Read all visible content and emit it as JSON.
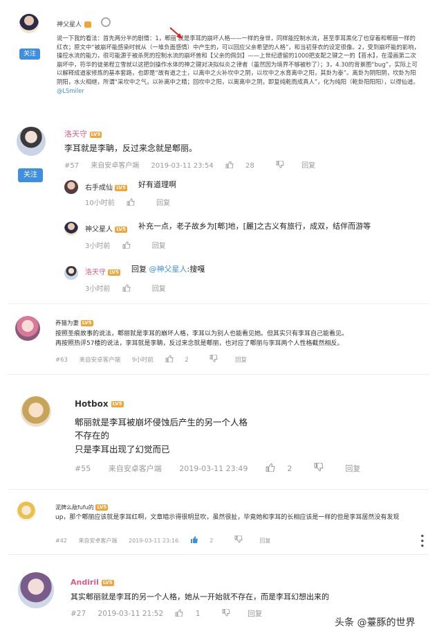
{
  "c1": {
    "name": "神父星人",
    "follow": "关注",
    "text": "说一下我的看法：首先两分半的剧情：1，郫丽 就是李耳的崩坏人格——一样的身世，同样能控制水流，甚至李耳黑化了也穿着和郫丽一样的红衣；原文中“被崩坏能感染时就从（一堆负面感情）中产生的，可以回应父亲希望的人格”，和当初芽衣的设定很像。2，受到崩坏能的影响，操控水流的能力，很可能源于被杀死的控制水流的崩坏兽和【父亲的佩剑】——上世纪遗留的1000把支配之键之一的【苔水】，在漫画第二次崩坏中，符华的徒弟程立雪就以这把剑操作水体的神之键对决拟似炎之律者（虽然因为境界不够被秒了）；3，4.30的背景图“bug”，实际上可以解释成道家修炼的基本套路，也即是“故有道之士，以离中之火补坎中之阴，以坎中之水育离中之阳，其卦为泰”。离卦为阴阳阴，坎卦为阳阴阳，水火相继，所谓“采坎中之气，以补离中之精；回坎中之阳，以离离中之阴，即复纯乾而成真人”，化为纯阳（乾卦阳阳阳），以得仙道。",
    "mention": "@LSmiler"
  },
  "c2": {
    "name": "洛天守",
    "level": "LV5",
    "follow": "关注",
    "text": "李耳就是李聃，反过来念就是郫丽。",
    "floor": "#57",
    "source": "来自安卓客户端",
    "time": "2019-03-11 23:54",
    "likes": "28",
    "reply": "回复",
    "replies": [
      {
        "name": "右手成仙",
        "level": "LV5",
        "text": "好有道理啊",
        "time": "10小时前",
        "reply": "回复"
      },
      {
        "name": "神父星人",
        "level": "LV5",
        "text": "补充一点，老子故乡为[郫]地，[麗]之古义有旅行，成双，结伴而游等",
        "time": "3小时前",
        "reply": "回复"
      },
      {
        "name": "洛天守",
        "level": "LV5",
        "prefix": "回复",
        "mention": "@神父星人",
        "suffix": ":搜嘎",
        "time": "3小时前",
        "reply": "回复"
      }
    ]
  },
  "c3": {
    "name": "养猫为妻",
    "level": "LV5",
    "text1": "按照圣痕故事的说法，郫丽就是李耳的崩坏人格，李耳以为别人也能看见她。但其实只有李耳自己能看见。",
    "text2": "再按照热评57楼的说法，李耳就是李聃，反过来念就是郫丽，也对应了郫丽与李耳两个人性格截然相反。",
    "floor": "#63",
    "source": "来自安卓客户端",
    "time": "9小时前",
    "likes": "2",
    "reply": "回复"
  },
  "c4": {
    "name": "Hotbox",
    "level": "LV5",
    "lines": [
      "郫丽就是李耳被崩坏侵蚀后产生的另一个人格",
      "不存在的",
      "只是李耳出现了幻觉而已"
    ],
    "floor": "#55",
    "source": "来自安卓客户端",
    "time": "2019-03-11 23:49",
    "likes": "2",
    "reply": "回复"
  },
  "c5": {
    "name": "泥牌么敌fufu的",
    "level": "LV5",
    "text": "up，那个郫丽应该就是李耳红啊，文章暗示得很明显吹，虽然很扯，毕竟她和李耳的长相应该是一样的但是李耳居然没有发现",
    "floor": "#42",
    "source": "来自安卓客户端",
    "time": "2019-03-11 23:16",
    "likes": "2",
    "reply": "回复"
  },
  "c6": {
    "name": "Andiril",
    "level": "LV5",
    "text": "其实郫丽就是李耳的另一个人格，她从一开始就不存在，而是李耳幻想出来的",
    "floor": "#27",
    "time": "2019-03-11 21:52",
    "likes": "1",
    "reply": "回复"
  },
  "watermark": "头条 @薹豚的世界",
  "colors": {
    "accent": "#3f8fe0",
    "pink": "#e05a8a",
    "level": "#f0a43a",
    "meta": "#999999"
  },
  "icons": [
    "thumb-up-icon",
    "thumb-down-icon",
    "more-options-icon",
    "red-arrow-icon"
  ]
}
